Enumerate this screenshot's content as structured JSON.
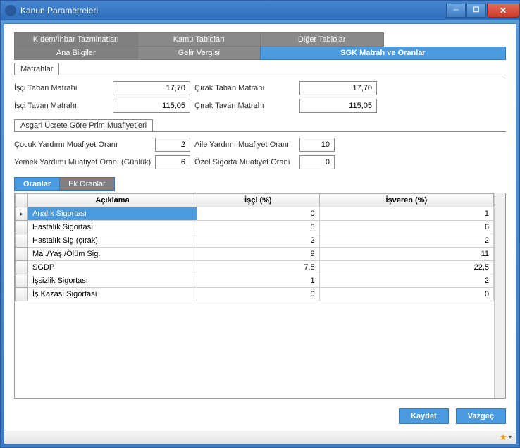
{
  "window": {
    "title": "Kanun Parametreleri"
  },
  "tabs_top": {
    "kidem": "Kıdem/İhbar Tazminatları",
    "kamu": "Kamu Tabloları",
    "diger": "Diğer Tablolar"
  },
  "tabs_bottom": {
    "ana": "Ana Bilgiler",
    "gelir": "Gelir Vergisi",
    "sgk": "SGK Matrah ve Oranlar"
  },
  "groups": {
    "matrahlar": "Matrahlar",
    "asgari": "Asgari Ücrete Göre Prim Muafiyetleri"
  },
  "fields": {
    "isci_taban_label": "İşçi Taban Matrahı",
    "isci_taban_value": "17,70",
    "cirak_taban_label": "Çırak Taban Matrahı",
    "cirak_taban_value": "17,70",
    "isci_tavan_label": "İşçi Tavan Matrahı",
    "isci_tavan_value": "115,05",
    "cirak_tavan_label": "Çırak Tavan Matrahı",
    "cirak_tavan_value": "115,05",
    "cocuk_label": "Çocuk Yardımı Muafiyet Oranı",
    "cocuk_value": "2",
    "aile_label": "Aile Yardımı Muafiyet Oranı",
    "aile_value": "10",
    "yemek_label": "Yemek Yardımı Muafiyet Oranı (Günlük)",
    "yemek_value": "6",
    "ozel_label": "Özel Sigorta Muafiyet Oranı",
    "ozel_value": "0"
  },
  "subtabs": {
    "oranlar": "Oranlar",
    "ek": "Ek Oranlar"
  },
  "grid": {
    "col_desc": "Açıklama",
    "col_isci": "İşçi (%)",
    "col_isveren": "İşveren (%)",
    "rows": [
      {
        "desc": "Analık Sigortası",
        "isci": "0",
        "isveren": "1"
      },
      {
        "desc": "Hastalık Sigortası",
        "isci": "5",
        "isveren": "6"
      },
      {
        "desc": "Hastalık Sig.(çırak)",
        "isci": "2",
        "isveren": "2"
      },
      {
        "desc": "Mal./Yaş./Ölüm Sig.",
        "isci": "9",
        "isveren": "11"
      },
      {
        "desc": "SGDP",
        "isci": "7,5",
        "isveren": "22,5"
      },
      {
        "desc": "İşsizlik Sigortası",
        "isci": "1",
        "isveren": "2"
      },
      {
        "desc": "İş Kazası Sigortası",
        "isci": "0",
        "isveren": "0"
      }
    ]
  },
  "buttons": {
    "save": "Kaydet",
    "cancel": "Vazgeç"
  }
}
